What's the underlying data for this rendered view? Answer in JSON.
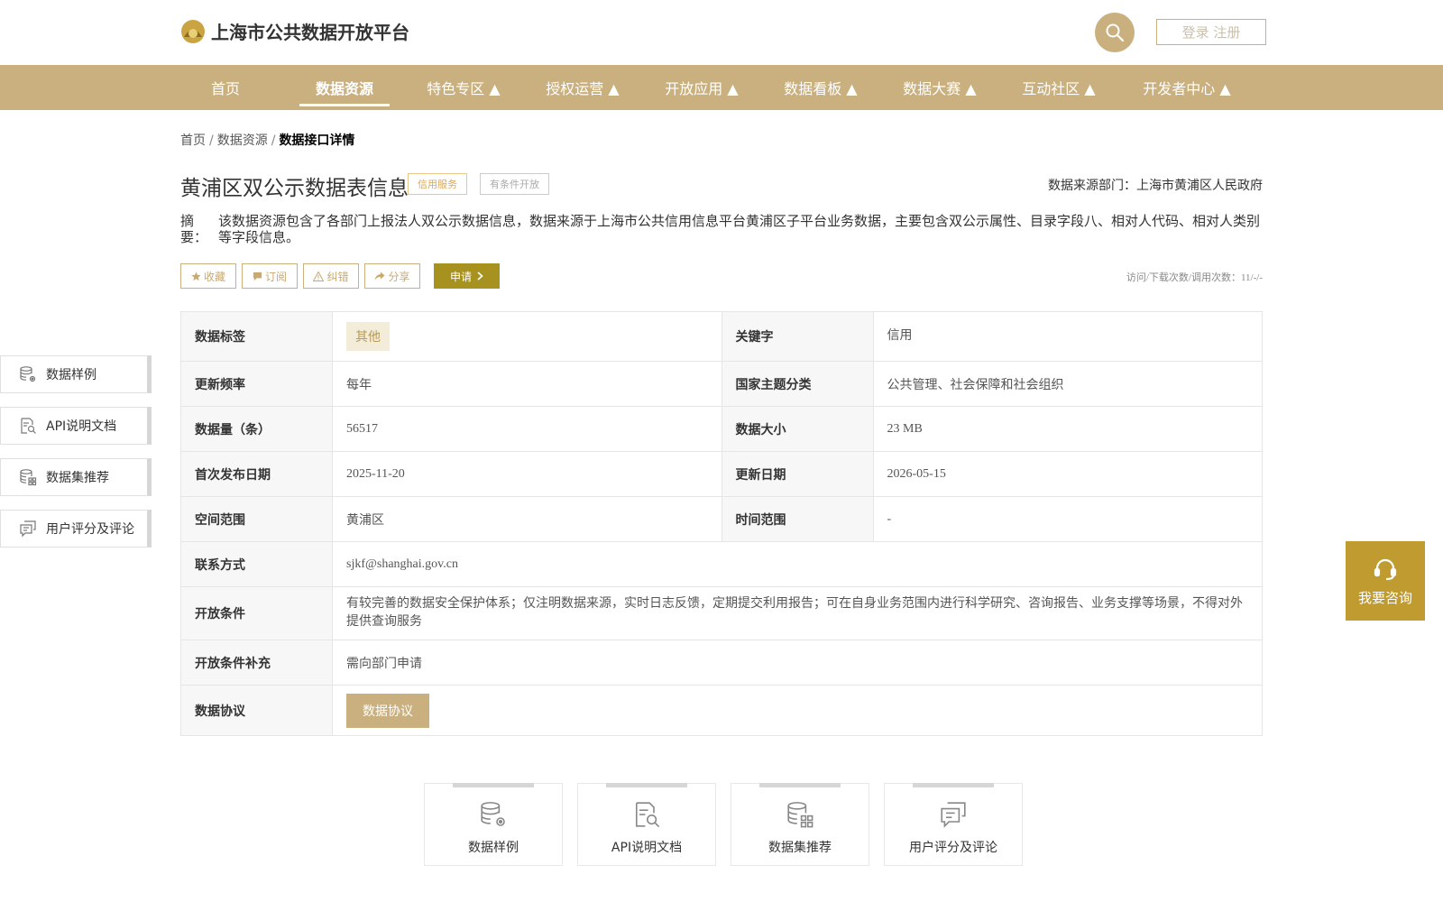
{
  "header": {
    "site_title": "上海市公共数据开放平台",
    "login_label": "登录 注册"
  },
  "nav": {
    "items": [
      {
        "label": "首页"
      },
      {
        "label": "数据资源"
      },
      {
        "label": "特色专区 ▲"
      },
      {
        "label": "授权运营 ▲"
      },
      {
        "label": "开放应用 ▲"
      },
      {
        "label": "数据看板 ▲"
      },
      {
        "label": "数据大赛 ▲"
      },
      {
        "label": "互动社区 ▲"
      },
      {
        "label": "开发者中心 ▲"
      }
    ],
    "active_index": 1
  },
  "breadcrumb": {
    "home": "首页",
    "resource": "数据资源",
    "current": "数据接口详情",
    "sep": "/"
  },
  "detail": {
    "title": "黄浦区双公示数据表信息",
    "tag_credit": "信用服务",
    "tag_condition": "有条件开放",
    "source": "数据来源部门：上海市黄浦区人民政府",
    "abstract_label": "摘　要：",
    "abstract_text": "该数据资源包含了各部门上报法人双公示数据信息，数据来源于上海市公共信用信息平台黄浦区子平台业务数据，主要包含双公示属性、目录字段八、相对人代码、相对人类别等字段信息。"
  },
  "actions": {
    "favorite": "收藏",
    "subscribe": "订阅",
    "report_error": "纠错",
    "share": "分享",
    "apply": "申请",
    "visits": "访问/下载次数/调用次数：11/-/-"
  },
  "info": {
    "data_tag_label": "数据标签",
    "data_tag_value": "其他",
    "keyword_label": "关键字",
    "keyword_value": "信用",
    "frequency_label": "更新频率",
    "frequency_value": "每年",
    "national_theme_label": "国家主题分类",
    "national_theme_value": "公共管理、社会保障和社会组织",
    "count_label": "数据量（条）",
    "count_value": "56517",
    "size_label": "数据大小",
    "size_value": "23 MB",
    "first_publish_label": "首次发布日期",
    "first_publish_value": "2025-11-20",
    "update_date_label": "更新日期",
    "update_date_value": "2026-05-15",
    "spatial_label": "空间范围",
    "spatial_value": "黄浦区",
    "time_label": "时间范围",
    "time_value": "-",
    "contact_label": "联系方式",
    "contact_value": "sjkf@shanghai.gov.cn",
    "open_cond_label": "开放条件",
    "open_cond_value": "有较完善的数据安全保护体系；仅注明数据来源，实时日志反馈，定期提交利用报告；可在自身业务范围内进行科学研究、咨询报告、业务支撑等场景，不得对外提供查询服务",
    "open_cond_extra_label": "开放条件补充",
    "open_cond_extra_value": "需向部门申请",
    "agreement_label": "数据协议",
    "agreement_button": "数据协议"
  },
  "side_nav": [
    {
      "label": "数据样例",
      "icon": "database-gear-icon"
    },
    {
      "label": "API说明文档",
      "icon": "document-search-icon"
    },
    {
      "label": "数据集推荐",
      "icon": "database-grid-icon"
    },
    {
      "label": "用户评分及评论",
      "icon": "comment-icon"
    }
  ],
  "consult": {
    "label": "我要咨询",
    "icon": "headset-icon"
  },
  "bottom_cards": [
    {
      "label": "数据样例",
      "icon": "database-gear-icon"
    },
    {
      "label": "API说明文档",
      "icon": "document-search-icon"
    },
    {
      "label": "数据集推荐",
      "icon": "database-grid-icon"
    },
    {
      "label": "用户评分及评论",
      "icon": "comment-icon"
    }
  ],
  "colors": {
    "primary": "#c9b07e",
    "apply": "#a8921f",
    "consult": "#bf9b30",
    "tag_credit": "#d9a85a"
  }
}
